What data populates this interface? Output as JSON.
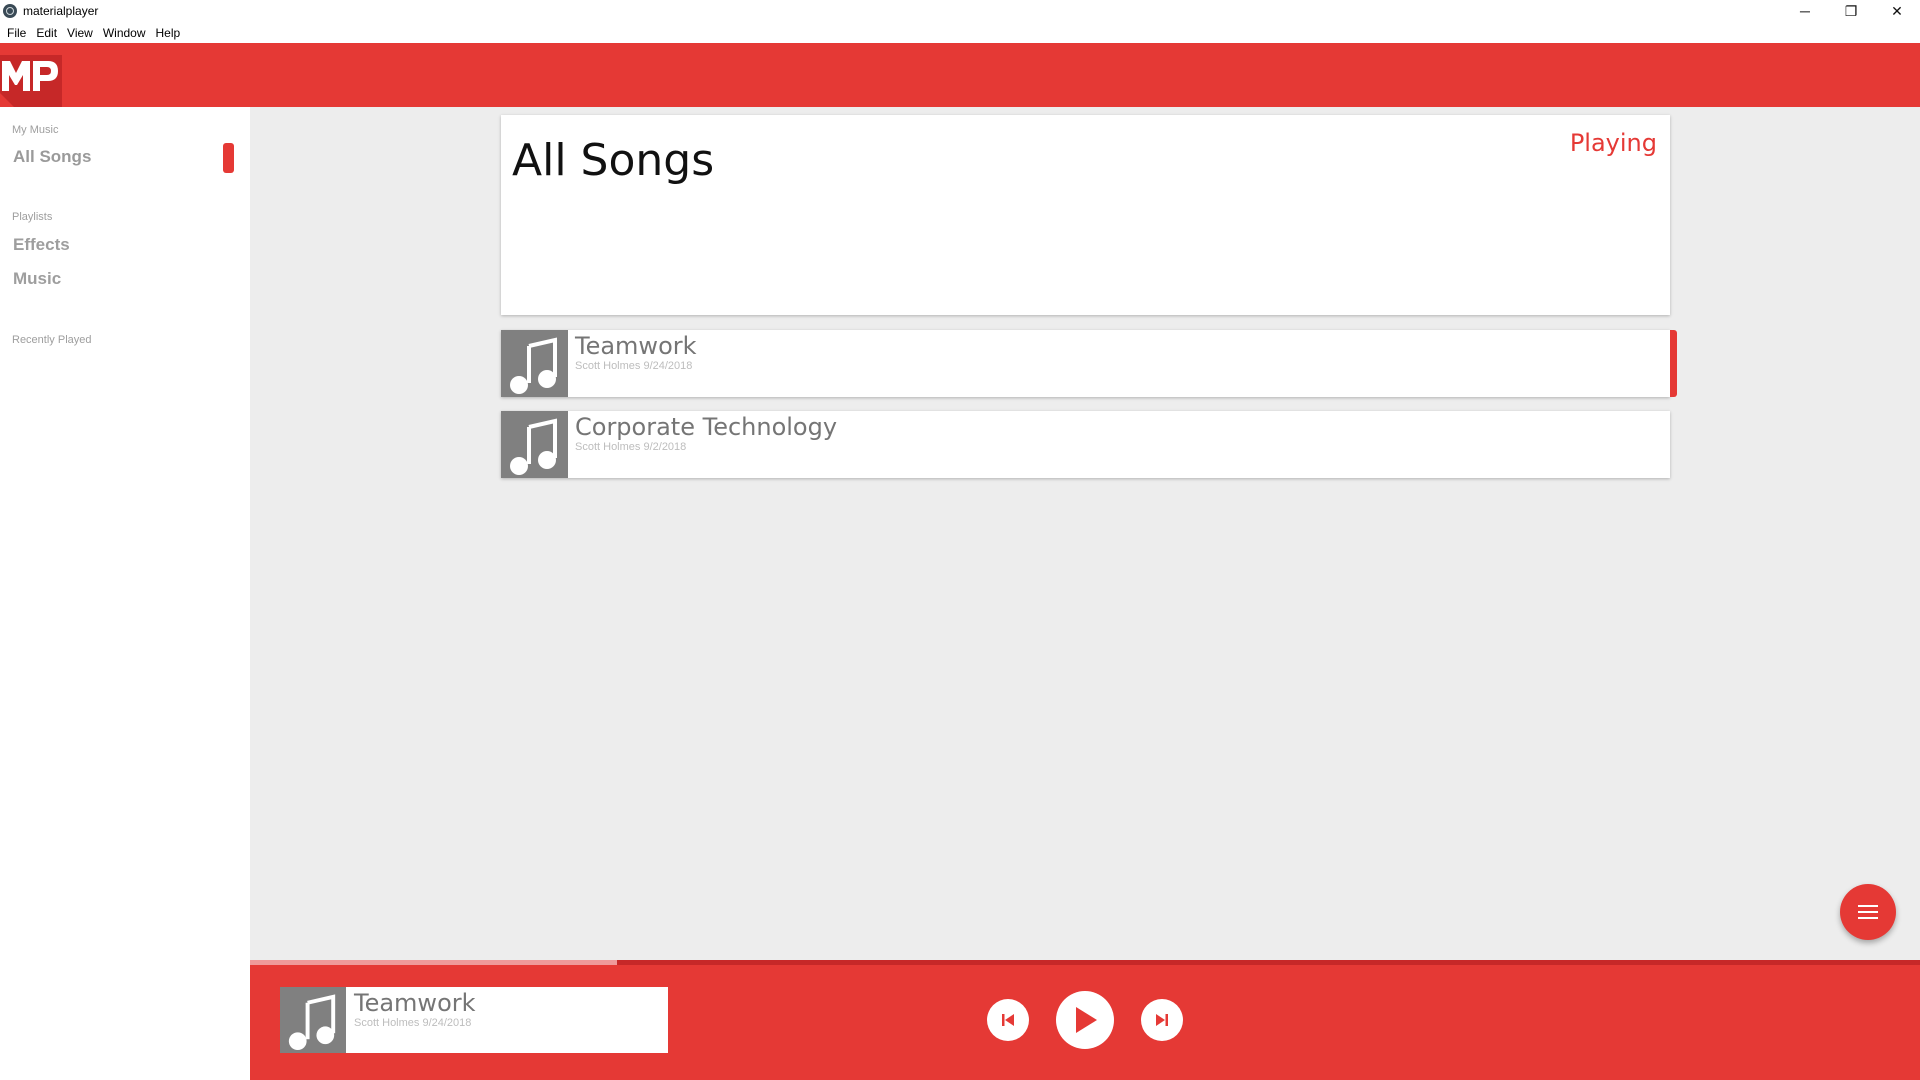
{
  "window": {
    "title": "materialplayer",
    "controls": {
      "minimize": "─",
      "restore": "❐",
      "close": "✕"
    }
  },
  "menu": [
    "File",
    "Edit",
    "View",
    "Window",
    "Help"
  ],
  "colors": {
    "accent": "#e53935",
    "progress_played": "#ef9a9a",
    "progress_track": "#c62828",
    "art_bg": "#808080"
  },
  "sidebar": {
    "sections": [
      {
        "label": "My Music",
        "items": [
          "All Songs"
        ]
      },
      {
        "label": "Playlists",
        "items": [
          "Effects",
          "Music"
        ]
      },
      {
        "label": "Recently Played",
        "items": []
      }
    ],
    "active_item": "All Songs"
  },
  "main": {
    "title": "All Songs",
    "playing_label": "Playing",
    "songs": [
      {
        "title": "Teamwork",
        "meta": "Scott Holmes 9/24/2018",
        "icon": "music-note-icon",
        "playing": true
      },
      {
        "title": "Corporate Technology",
        "meta": "Scott Holmes 9/2/2018",
        "icon": "music-note-icon",
        "playing": false
      }
    ]
  },
  "fab": {
    "icon": "menu-icon"
  },
  "player": {
    "now_playing": {
      "title": "Teamwork",
      "meta": "Scott Holmes 9/24/2018",
      "icon": "music-note-icon"
    },
    "progress": 0.22,
    "controls": [
      "skip-previous-icon",
      "play-icon",
      "skip-next-icon"
    ]
  }
}
